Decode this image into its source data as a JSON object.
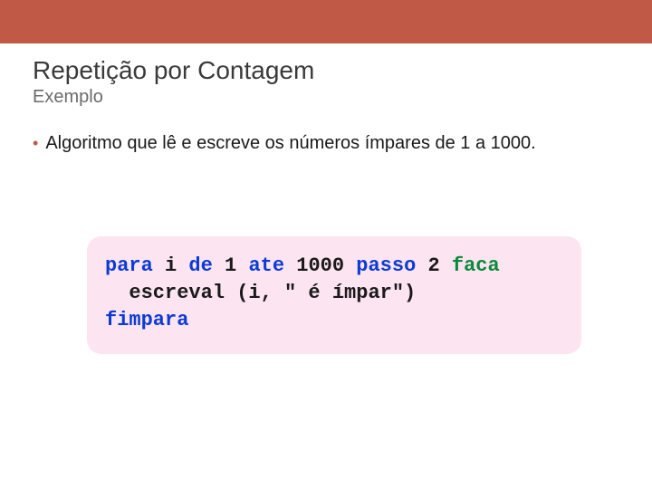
{
  "title": "Repetição por Contagem",
  "subtitle": "Exemplo",
  "bullet": "Algoritmo que lê e escreve os números ímpares de 1 a 1000.",
  "code": {
    "kw_para": "para",
    "seg1": " i ",
    "kw_de": "de",
    "seg2": " 1 ",
    "kw_ate": "ate",
    "seg3": " 1000 ",
    "kw_passo": "passo",
    "seg4": " 2 ",
    "kw_faca": "faca",
    "line2": "  escreval (i, \" é ímpar\")",
    "kw_fimpara": "fimpara"
  }
}
